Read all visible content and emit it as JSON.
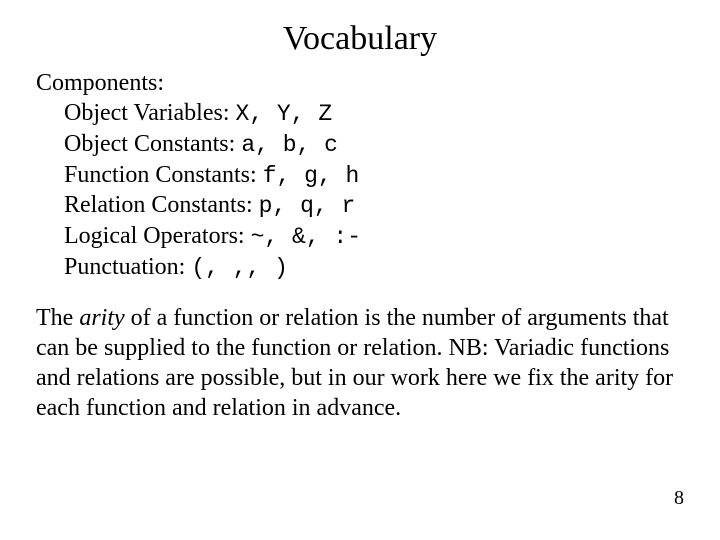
{
  "title": "Vocabulary",
  "components_label": "Components:",
  "rows": [
    {
      "label": "Object Variables: ",
      "symbols": "X, Y, Z"
    },
    {
      "label": "Object Constants: ",
      "symbols": "a, b, c"
    },
    {
      "label": "Function Constants: ",
      "symbols": "f, g, h"
    },
    {
      "label": "Relation Constants: ",
      "symbols": "p, q, r"
    },
    {
      "label": "Logical Operators: ",
      "symbols": "~, &, :-"
    },
    {
      "label": "Punctuation: ",
      "symbols": "(, ,, )"
    }
  ],
  "arity": {
    "pre": "The ",
    "word": "arity",
    "post": " of a function or relation is the number of arguments that can be supplied to the function or relation.  NB: Variadic functions and relations are possible, but in our work here we fix the arity for each function and relation in advance."
  },
  "page_number": "8"
}
